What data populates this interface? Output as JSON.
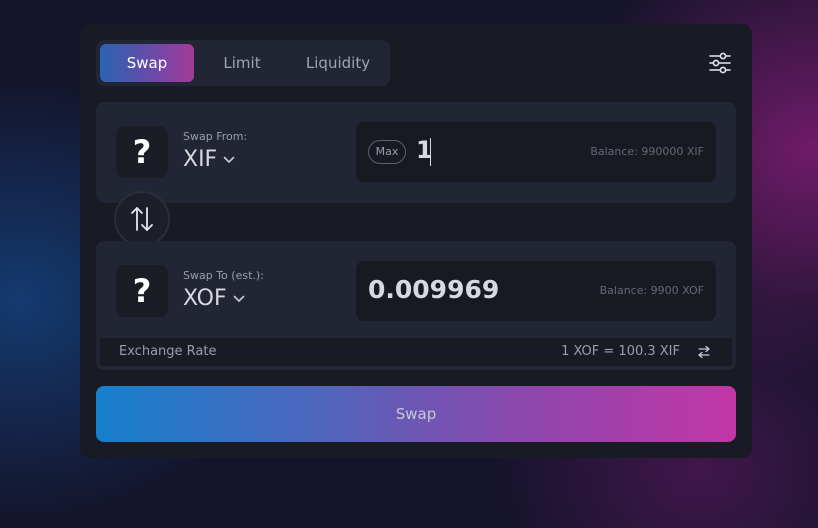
{
  "tabs": [
    {
      "label": "Swap",
      "active": true
    },
    {
      "label": "Limit",
      "active": false
    },
    {
      "label": "Liquidity",
      "active": false
    }
  ],
  "from": {
    "label": "Swap From:",
    "token": "XIF",
    "icon_glyph": "?",
    "max_label": "Max",
    "amount": "1",
    "balance": "Balance: 990000 XIF"
  },
  "to": {
    "label": "Swap To (est.):",
    "token": "XOF",
    "icon_glyph": "?",
    "amount": "0.009969",
    "balance": "Balance: 9900 XOF"
  },
  "rate": {
    "label": "Exchange Rate",
    "value": "1 XOF = 100.3 XIF"
  },
  "action": {
    "label": "Swap"
  },
  "icons": {
    "settings": "sliders-icon",
    "swap_direction": "swap-vertical-icon",
    "rate_toggle": "swap-horizontal-icon",
    "token_unknown": "question-mark-icon",
    "dropdown": "chevron-down-icon"
  },
  "colors": {
    "card_bg": "#181a24",
    "panel_bg": "#222533",
    "field_bg": "#181a22",
    "text_primary": "#d7d8e0",
    "text_muted": "#9b9eae",
    "gradient_start": "#1680ce",
    "gradient_end": "#c336a6"
  }
}
